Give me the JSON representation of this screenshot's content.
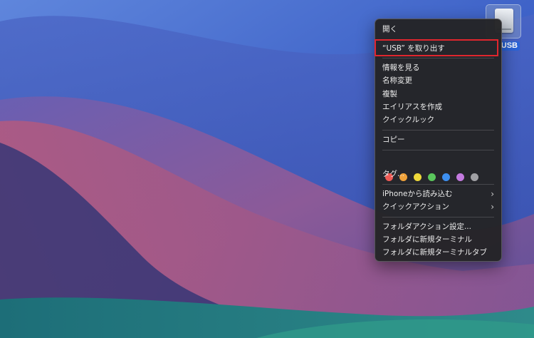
{
  "desktop": {
    "drive": {
      "label": "USB",
      "icon": "usb-drive-icon"
    }
  },
  "menu": {
    "items": [
      {
        "label": "開く"
      },
      {
        "label": "“USB” を取り出す"
      },
      {
        "label": "情報を見る"
      },
      {
        "label": "名称変更"
      },
      {
        "label": "複製"
      },
      {
        "label": "エイリアスを作成"
      },
      {
        "label": "クイックルック"
      },
      {
        "label": "コピー"
      },
      {
        "label": "タグ..."
      },
      {
        "label": "iPhoneから読み込む"
      },
      {
        "label": "クイックアクション"
      },
      {
        "label": "フォルダアクション設定..."
      },
      {
        "label": "フォルダに新規ターミナル"
      },
      {
        "label": "フォルダに新規ターミナルタブ"
      }
    ],
    "submenu_glyph": "›",
    "tag_colors": [
      "#ee5a55",
      "#f0a23a",
      "#eed83a",
      "#5ac65c",
      "#3d8ff0",
      "#c47ae0",
      "#a0a0a4"
    ],
    "highlight_color": "#e0262e"
  }
}
